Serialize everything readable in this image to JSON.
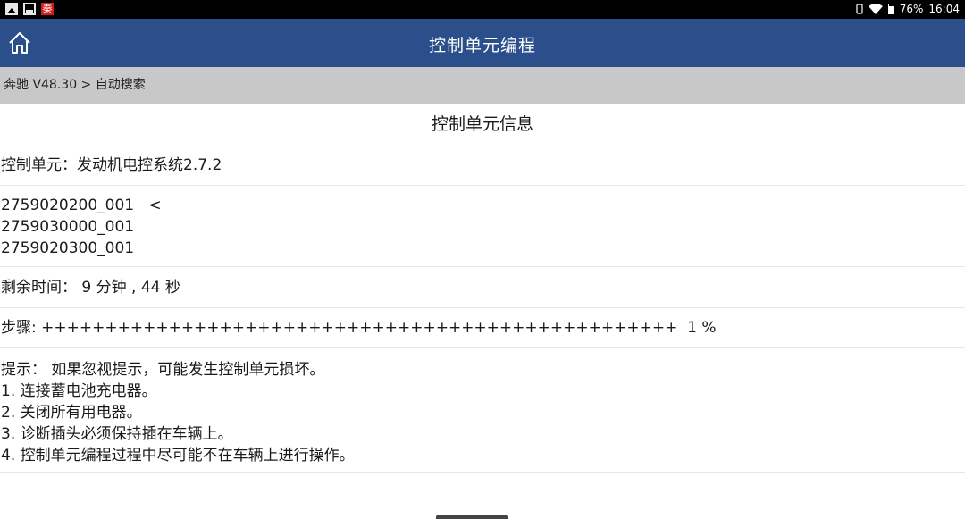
{
  "statusbar": {
    "battery_text": "76%",
    "time": "16:04",
    "app_icon_char": "秦"
  },
  "header": {
    "title": "控制单元编程",
    "home_icon": "home-icon"
  },
  "breadcrumb": "奔驰 V48.30 > 自动搜索",
  "section_title": "控制单元信息",
  "control_unit": "控制单元：发动机电控系统2.7.2",
  "part_numbers": [
    "2759020200_001   <",
    "2759030000_001",
    "2759020300_001"
  ],
  "remaining_time": "剩余时间： 9 分钟 , 44 秒",
  "progress": {
    "label": "步骤: ++++++++++++++++++++++++++++++++++++++++++++++++++  1 %",
    "percent": 1
  },
  "notes": [
    "提示： 如果忽视提示，可能发生控制单元损坏。",
    "1. 连接蓄电池充电器。",
    "2. 关闭所有用电器。",
    "3. 诊断插头必须保持插在车辆上。",
    "4. 控制单元编程过程中尽可能不在车辆上进行操作。"
  ],
  "colors": {
    "header_bg": "#2b4f8b",
    "breadcrumb_bg": "#c8c8c8"
  }
}
